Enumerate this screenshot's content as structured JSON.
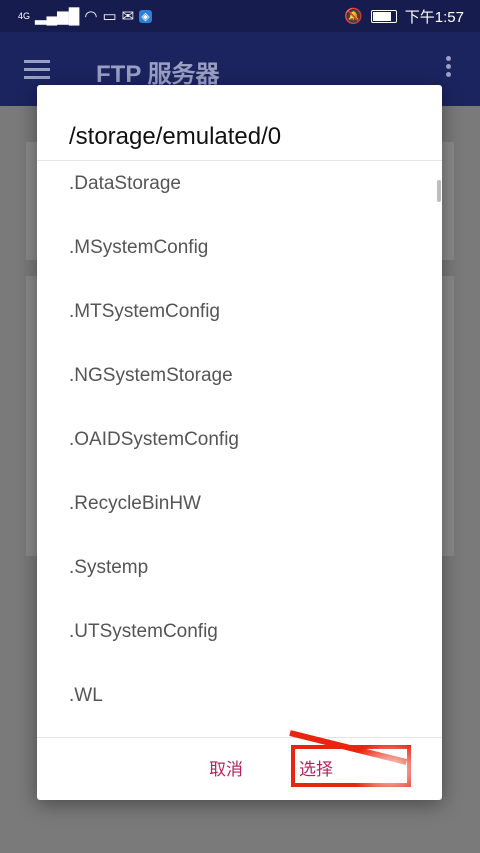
{
  "status_bar": {
    "network": "4G",
    "time": "下午1:57"
  },
  "app_bar": {
    "title": "FTP 服务器"
  },
  "dialog": {
    "title": "/storage/emulated/0",
    "items": [
      ".DataStorage",
      ".MSystemConfig",
      ".MTSystemConfig",
      ".NGSystemStorage",
      ".OAIDSystemConfig",
      ".RecycleBinHW",
      ".Systemp",
      ".UTSystemConfig",
      ".WL"
    ],
    "cancel_label": "取消",
    "confirm_label": "选择"
  },
  "colors": {
    "accent": "#b3245f",
    "app_bar": "#1c2460",
    "highlight": "#e8250f"
  }
}
